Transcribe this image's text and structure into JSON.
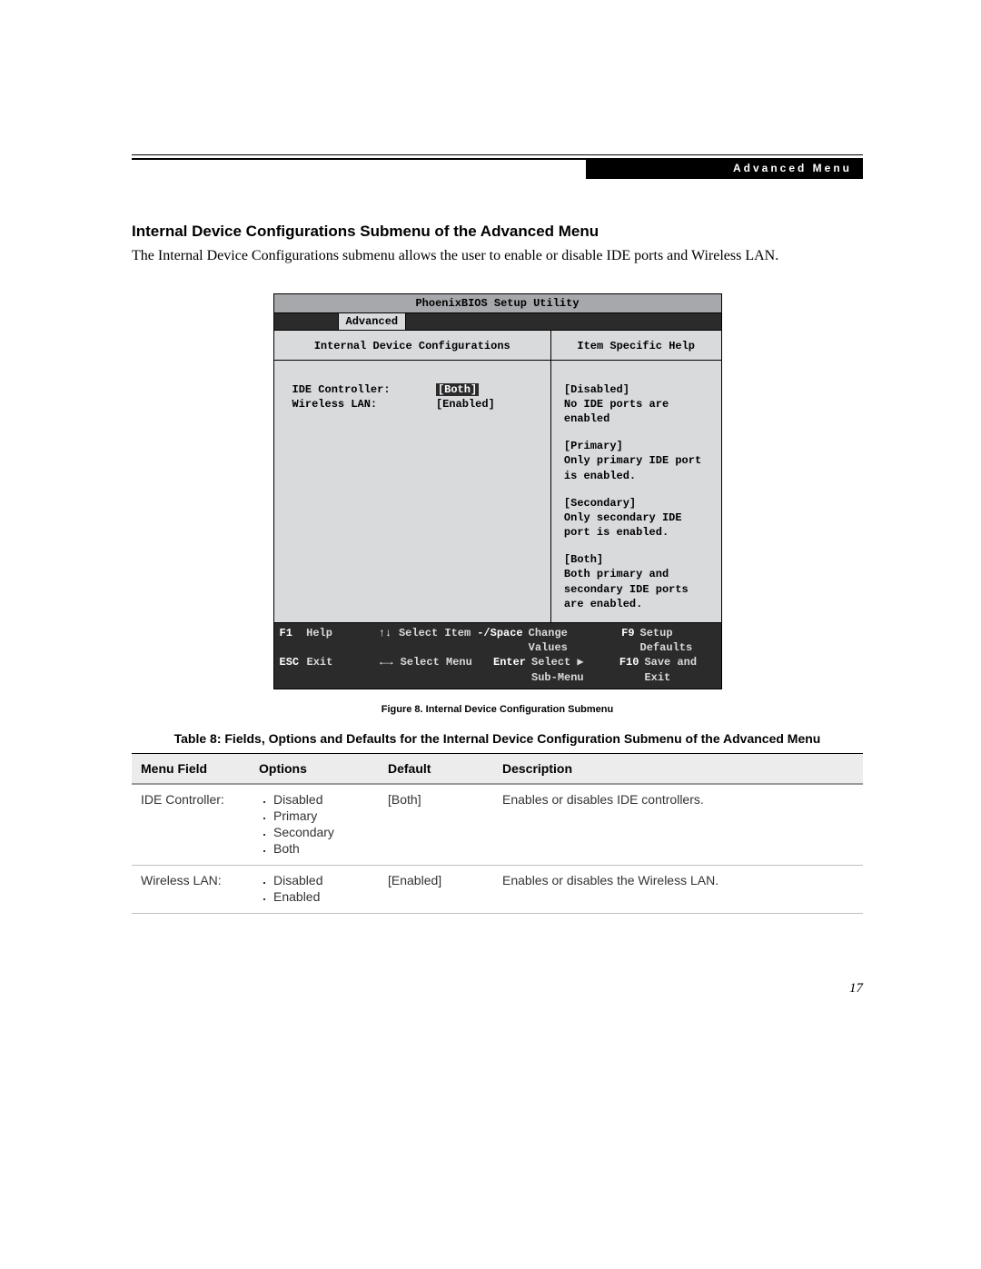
{
  "header": {
    "label": "Advanced Menu"
  },
  "section": {
    "title": "Internal Device Configurations Submenu of the Advanced Menu",
    "intro": "The Internal Device Configurations submenu allows the user to enable or disable IDE ports and Wireless LAN."
  },
  "bios": {
    "utility_title": "PhoenixBIOS Setup Utility",
    "tab": "Advanced",
    "left_title": "Internal Device Configurations",
    "right_title": "Item Specific Help",
    "fields": {
      "ide_label": "IDE Controller:",
      "ide_value": "[Both]",
      "wlan_label": "Wireless LAN:",
      "wlan_value": "[Enabled]"
    },
    "help": {
      "b1_title": "[Disabled]",
      "b1_text": "No IDE ports are enabled",
      "b2_title": "[Primary]",
      "b2_text": "Only primary IDE port is enabled.",
      "b3_title": "[Secondary]",
      "b3_text": "Only secondary IDE port is enabled.",
      "b4_title": "[Both]",
      "b4_text": "Both primary and secondary IDE ports are enabled."
    },
    "footer": {
      "f1_key": "F1",
      "f1_label": "Help",
      "f2_key": "↑↓",
      "f2_label": "Select Item",
      "f3_key": "-/Space",
      "f3_label": "Change Values",
      "f4_key": "F9",
      "f4_label": "Setup Defaults",
      "g1_key": "ESC",
      "g1_label": "Exit",
      "g2_key": "←→",
      "g2_label": "Select Menu",
      "g3_key": "Enter",
      "g3_label": "Select ▶ Sub-Menu",
      "g4_key": "F10",
      "g4_label": "Save and Exit"
    }
  },
  "captions": {
    "figure": "Figure 8.  Internal Device Configuration Submenu",
    "table": "Table 8: Fields, Options and Defaults for the Internal Device Configuration Submenu of the Advanced Menu"
  },
  "table": {
    "headers": {
      "field": "Menu Field",
      "options": "Options",
      "def": "Default",
      "desc": "Description"
    },
    "rows": [
      {
        "field": "IDE Controller:",
        "options": [
          "Disabled",
          "Primary",
          "Secondary",
          "Both"
        ],
        "def": "[Both]",
        "desc": "Enables or disables IDE controllers."
      },
      {
        "field": "Wireless LAN:",
        "options": [
          "Disabled",
          "Enabled"
        ],
        "def": "[Enabled]",
        "desc": "Enables or disables the Wireless LAN."
      }
    ]
  },
  "page_number": "17"
}
